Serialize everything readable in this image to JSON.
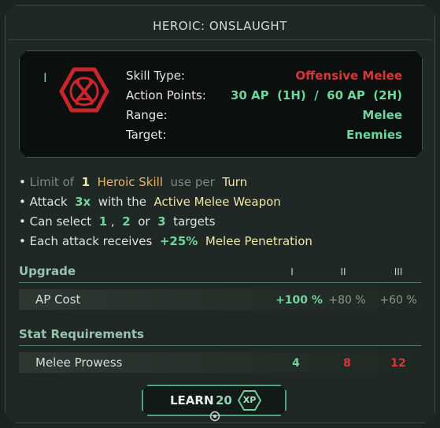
{
  "title": "HEROIC: ONSLAUGHT",
  "skill": {
    "tier_mark": "I",
    "icon": "crossed-swords-triangle-emblem",
    "stats": [
      {
        "label": "Skill Type:",
        "value": "Offensive Melee",
        "color": "#d9363a"
      },
      {
        "label": "Action Points:",
        "value": "30 AP  (1H)  /  60 AP  (2H)",
        "color": "#6fd49e"
      },
      {
        "label": "Range:",
        "value": "Melee",
        "color": "#6fd49e"
      },
      {
        "label": "Target:",
        "value": "Enemies",
        "color": "#6fd49e"
      }
    ]
  },
  "bullets": {
    "b1": {
      "p1": "Limit of",
      "n": "1",
      "p2": "Heroic Skill",
      "p3": "use per",
      "p4": "Turn"
    },
    "b2": {
      "p1": "Attack",
      "n": "3x",
      "p2": "with the",
      "p3": "Active Melee Weapon"
    },
    "b3": {
      "p1": "Can select",
      "n1": "1",
      "sep1": ",",
      "n2": "2",
      "p2": "or",
      "n3": "3",
      "p3": "targets"
    },
    "b4": {
      "p1": "Each attack receives",
      "n": "+25%",
      "p2": "Melee Penetration"
    }
  },
  "upgrade": {
    "heading": "Upgrade",
    "columns": [
      "I",
      "II",
      "III"
    ],
    "row_label": "AP Cost",
    "values": [
      "+100 %",
      "+80 %",
      "+60 %"
    ]
  },
  "requirements": {
    "heading": "Stat Requirements",
    "row_label": "Melee Prowess",
    "values": [
      "4",
      "8",
      "12"
    ],
    "colors": [
      "#6fd49e",
      "#d9363a",
      "#d9363a"
    ]
  },
  "learn": {
    "label": "LEARN",
    "cost": "20",
    "currency": "XP"
  }
}
